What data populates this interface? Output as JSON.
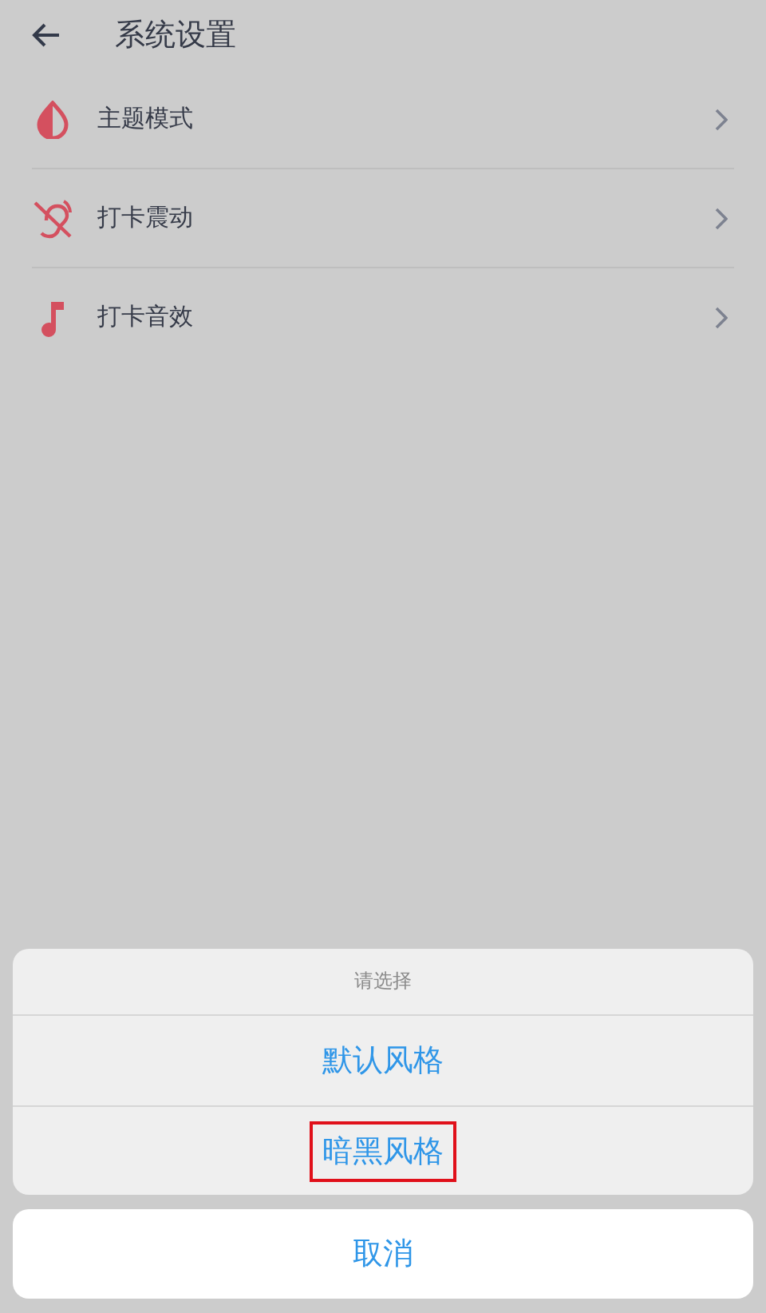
{
  "header": {
    "title": "系统设置"
  },
  "settings": [
    {
      "kind": "theme",
      "label": "主题模式"
    },
    {
      "kind": "vibration",
      "label": "打卡震动"
    },
    {
      "kind": "sound",
      "label": "打卡音效"
    }
  ],
  "sheet": {
    "title": "请选择",
    "options": [
      {
        "label": "默认风格",
        "highlighted": false
      },
      {
        "label": "暗黑风格",
        "highlighted": true
      }
    ],
    "cancel": "取消"
  }
}
